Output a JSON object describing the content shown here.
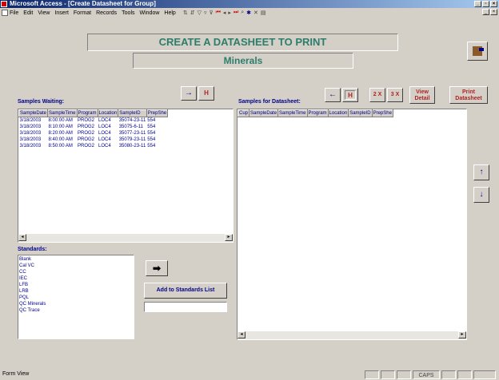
{
  "window": {
    "title": "Microsoft Access - [Create Datasheet for Group]"
  },
  "menu": [
    "File",
    "Edit",
    "View",
    "Insert",
    "Format",
    "Records",
    "Tools",
    "Window",
    "Help"
  ],
  "header": {
    "title": "CREATE A DATASHEET TO PRINT",
    "subtitle": "Minerals"
  },
  "waiting": {
    "label": "Samples Waiting:",
    "columns": [
      "SampleDate",
      "SampleTime",
      "Program",
      "Location",
      "SampleID",
      "PrepShe"
    ],
    "rows": [
      [
        "3/18/2003",
        "8:00:00 AM",
        "PROG2",
        "LOC4",
        "35074-23-11",
        "554"
      ],
      [
        "3/18/2003",
        "8:10:00 AM",
        "PROG2",
        "LOC4",
        "35075-6-11",
        "554"
      ],
      [
        "3/18/2003",
        "8:20:00 AM",
        "PROG2",
        "LOC4",
        "35077-23-11",
        "554"
      ],
      [
        "3/18/2003",
        "8:40:00 AM",
        "PROG2",
        "LOC4",
        "35079-23-11",
        "554"
      ],
      [
        "3/18/2003",
        "8:50:00 AM",
        "PROG2",
        "LOC4",
        "35080-23-11",
        "554"
      ]
    ]
  },
  "datasheet": {
    "label": "Samples for Datasheet:",
    "columns": [
      "Cup",
      "SampleDate",
      "SampleTime",
      "Program",
      "Location",
      "SampleID",
      "PrepShe"
    ]
  },
  "buttons": {
    "move_right": "→",
    "move_all_right": "H",
    "move_left": "←",
    "move_all_left": "H",
    "two_x": "2 X",
    "three_x": "3 X",
    "view_detail": "View Detail",
    "print_datasheet": "Print Datasheet",
    "add_standard_arrow": "➡",
    "add_to_standards": "Add to Standards List",
    "move_up": "↑",
    "move_down": "↓"
  },
  "standards": {
    "label": "Standards:",
    "items": [
      "Blank",
      "Cal VC",
      "CC",
      "IEC",
      "LFB",
      "LRB",
      "PQL",
      "QC Minerals",
      "QC Trace"
    ],
    "new_value": ""
  },
  "status": {
    "left": "Form View",
    "caps": "CAPS"
  },
  "colors": {
    "accent_title": "#2e7d6b",
    "button_text": "#b22222",
    "list_text": "#00008b"
  },
  "icons": {
    "exit": "door-exit-icon"
  }
}
